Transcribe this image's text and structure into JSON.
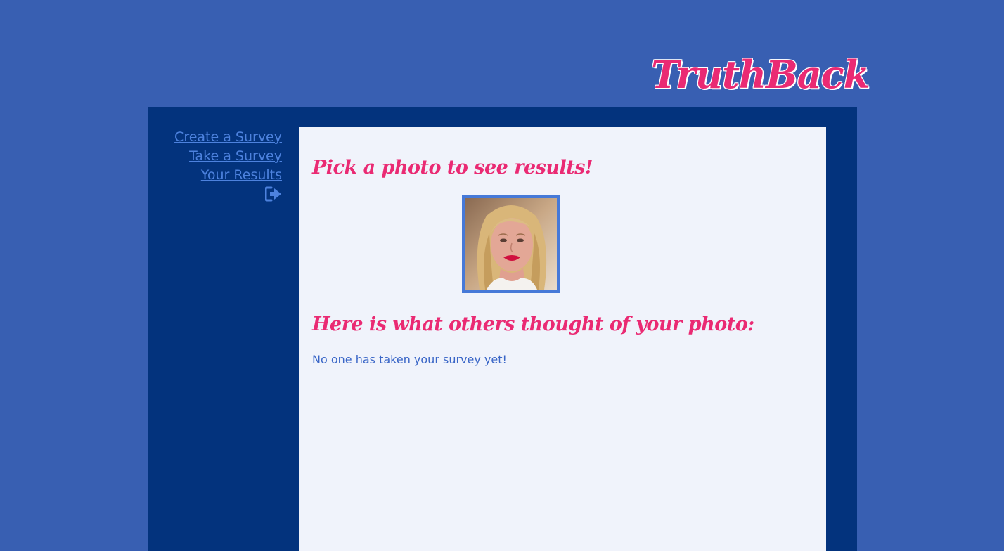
{
  "header": {
    "logo_text": "TruthBack"
  },
  "nav": {
    "items": [
      {
        "label": "Create a Survey"
      },
      {
        "label": "Take a Survey"
      },
      {
        "label": "Your Results"
      }
    ],
    "logout_icon": "sign-out-icon"
  },
  "main": {
    "pick_heading": "Pick a photo to see results!",
    "results_heading": "Here is what others thought of your photo:",
    "empty_message": "No one has taken your survey yet!",
    "photos": [
      {
        "subject": "profile photo of a smiling woman with blonde hair"
      }
    ]
  },
  "colors": {
    "page_background": "#385fb2",
    "frame_background": "#03337d",
    "content_background": "#f0f3fb",
    "accent_pink": "#ea2a73",
    "link_blue": "#4d82de",
    "photo_border": "#4679d8"
  }
}
